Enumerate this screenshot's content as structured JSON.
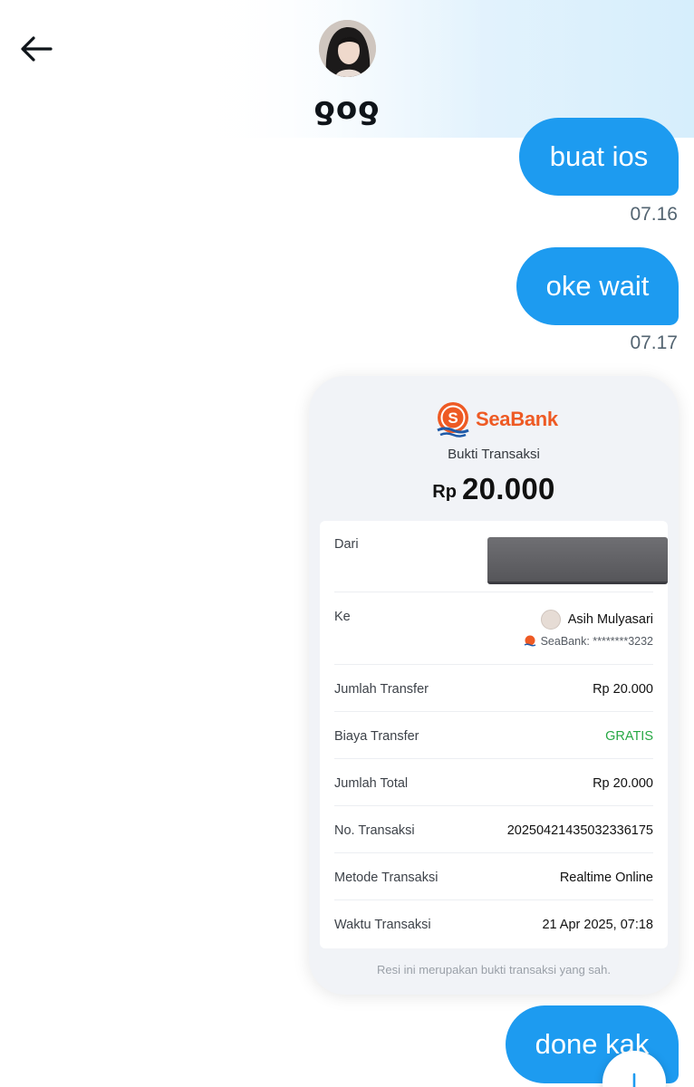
{
  "header": {
    "contact_name": "ƍoƍ"
  },
  "messages": [
    {
      "text": "buat ios",
      "time": "07.16"
    },
    {
      "text": "oke wait",
      "time": "07.17"
    },
    {
      "text": "done kak"
    }
  ],
  "receipt": {
    "bank": "SeaBank",
    "logo_letter": "S",
    "title": "Bukti Transaksi",
    "currency": "Rp",
    "amount": "20.000",
    "rows": {
      "dari_label": "Dari",
      "ke_label": "Ke",
      "ke_name": "Asih Mulyasari",
      "ke_account": "SeaBank: ********3232",
      "jumlah_transfer_label": "Jumlah Transfer",
      "jumlah_transfer_value": "Rp 20.000",
      "biaya_label": "Biaya Transfer",
      "biaya_value": "GRATIS",
      "total_label": "Jumlah Total",
      "total_value": "Rp 20.000",
      "no_label": "No. Transaksi",
      "no_value": "20250421435032336175",
      "metode_label": "Metode Transaksi",
      "metode_value": "Realtime Online",
      "waktu_label": "Waktu Transaksi",
      "waktu_value": "21 Apr 2025, 07:18"
    },
    "footer": "Resi ini merupakan bukti transaksi yang sah."
  },
  "colors": {
    "bubble": "#1d9bf0",
    "brand_orange": "#ee5a24",
    "gratis_green": "#27a844"
  },
  "icons": {
    "back": "arrow-left-icon",
    "scroll": "arrow-down-icon"
  }
}
